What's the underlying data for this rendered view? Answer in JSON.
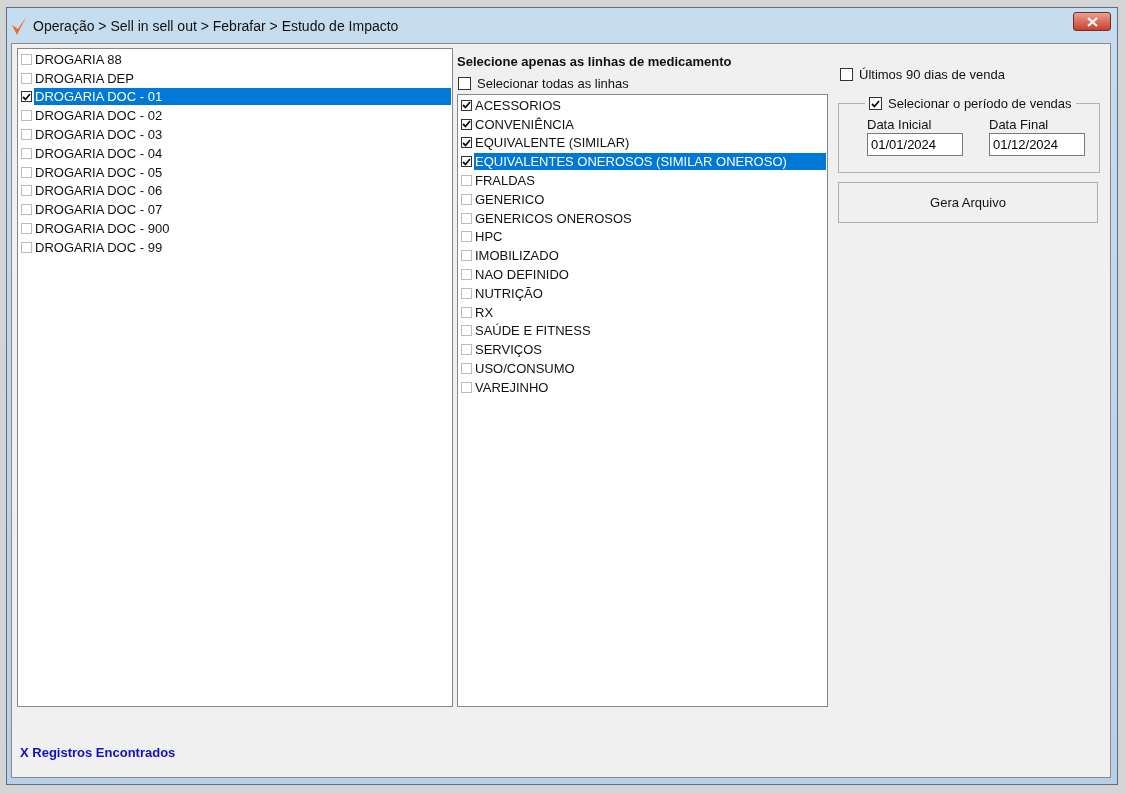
{
  "window": {
    "title": "Operação > Sell in sell out > Febrafar > Estudo de Impacto"
  },
  "stores": [
    {
      "label": "DROGARIA 88",
      "checked": false,
      "selected": false
    },
    {
      "label": "DROGARIA DEP",
      "checked": false,
      "selected": false
    },
    {
      "label": "DROGARIA DOC - 01",
      "checked": true,
      "selected": true
    },
    {
      "label": "DROGARIA DOC - 02",
      "checked": false,
      "selected": false
    },
    {
      "label": "DROGARIA DOC - 03",
      "checked": false,
      "selected": false
    },
    {
      "label": "DROGARIA DOC - 04",
      "checked": false,
      "selected": false
    },
    {
      "label": "DROGARIA DOC - 05",
      "checked": false,
      "selected": false
    },
    {
      "label": "DROGARIA DOC - 06",
      "checked": false,
      "selected": false
    },
    {
      "label": "DROGARIA DOC - 07",
      "checked": false,
      "selected": false
    },
    {
      "label": "DROGARIA DOC - 900",
      "checked": false,
      "selected": false
    },
    {
      "label": "DROGARIA DOC - 99",
      "checked": false,
      "selected": false
    }
  ],
  "lines_heading": "Selecione apenas as linhas de medicamento",
  "select_all": {
    "label": "Selecionar todas as linhas",
    "checked": false
  },
  "lines": [
    {
      "label": "ACESSORIOS",
      "checked": true,
      "selected": false
    },
    {
      "label": "CONVENIÊNCIA",
      "checked": true,
      "selected": false
    },
    {
      "label": "EQUIVALENTE (SIMILAR)",
      "checked": true,
      "selected": false
    },
    {
      "label": "EQUIVALENTES ONEROSOS (SIMILAR ONEROSO)",
      "checked": true,
      "selected": true
    },
    {
      "label": "FRALDAS",
      "checked": false,
      "selected": false
    },
    {
      "label": "GENERICO",
      "checked": false,
      "selected": false
    },
    {
      "label": "GENERICOS ONEROSOS",
      "checked": false,
      "selected": false
    },
    {
      "label": "HPC",
      "checked": false,
      "selected": false
    },
    {
      "label": "IMOBILIZADO",
      "checked": false,
      "selected": false
    },
    {
      "label": "NAO DEFINIDO",
      "checked": false,
      "selected": false
    },
    {
      "label": "NUTRIÇÃO",
      "checked": false,
      "selected": false
    },
    {
      "label": "RX",
      "checked": false,
      "selected": false
    },
    {
      "label": "SAÚDE E FITNESS",
      "checked": false,
      "selected": false
    },
    {
      "label": "SERVIÇOS",
      "checked": false,
      "selected": false
    },
    {
      "label": "USO/CONSUMO",
      "checked": false,
      "selected": false
    },
    {
      "label": "VAREJINHO",
      "checked": false,
      "selected": false
    }
  ],
  "last_90_days": {
    "label": "Últimos 90 dias de venda",
    "checked": false
  },
  "period": {
    "label": "Selecionar o período de vendas",
    "checked": true,
    "start": {
      "label": "Data Inicial",
      "value": "01/01/2024"
    },
    "end": {
      "label": "Data Final",
      "value": "01/12/2024"
    }
  },
  "generate_button": "Gera Arquivo",
  "status": "X Registros Encontrados"
}
